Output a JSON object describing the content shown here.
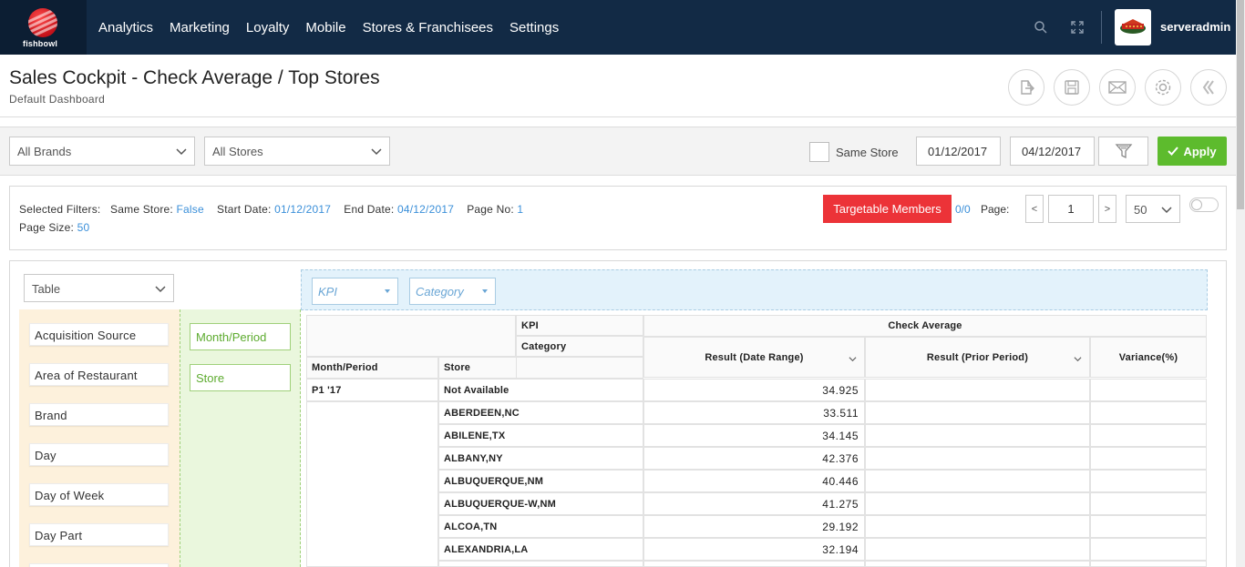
{
  "brand": {
    "logo_text": "fishbowl"
  },
  "nav": {
    "items": [
      "Analytics",
      "Marketing",
      "Loyalty",
      "Mobile",
      "Stores & Franchisees",
      "Settings"
    ]
  },
  "user": {
    "name": "serveradmin"
  },
  "header": {
    "title": "Sales Cockpit - Check Average / Top Stores",
    "subtitle": "Default Dashboard"
  },
  "filters": {
    "brands": "All Brands",
    "stores": "All Stores",
    "same_store_label": "Same Store",
    "start_date": "01/12/2017",
    "end_date": "04/12/2017",
    "apply_label": "Apply"
  },
  "selected": {
    "label": "Selected Filters:",
    "same_store_label": "Same Store:",
    "same_store": "False",
    "start_label": "Start Date:",
    "start": "01/12/2017",
    "end_label": "End Date:",
    "end": "04/12/2017",
    "page_no_label": "Page No:",
    "page_no": "1",
    "page_size_label": "Page Size:",
    "page_size": "50"
  },
  "paging": {
    "targetable_label": "Targetable Members",
    "count": "0/0",
    "page_label": "Page:",
    "prev": "<",
    "next": ">",
    "page": "1",
    "size": "50"
  },
  "pivot": {
    "view": "Table",
    "attributes": [
      "Acquisition Source",
      "Area of Restaurant",
      "Brand",
      "Day",
      "Day of Week",
      "Day Part"
    ],
    "rows": [
      "Month/Period",
      "Store"
    ],
    "columns": [
      "KPI",
      "Category"
    ]
  },
  "table": {
    "kpi_label": "KPI",
    "category_label": "Category",
    "month_header": "Month/Period",
    "store_header": "Store",
    "group_header": "Check Average",
    "col_result": "Result (Date Range)",
    "col_prior": "Result (Prior Period)",
    "col_variance": "Variance(%)",
    "period": "P1 '17",
    "rows": [
      {
        "store": "Not Available",
        "value": "34.925"
      },
      {
        "store": "ABERDEEN,NC",
        "value": "33.511"
      },
      {
        "store": "ABILENE,TX",
        "value": "34.145"
      },
      {
        "store": "ALBANY,NY",
        "value": "42.376"
      },
      {
        "store": "ALBUQUERQUE,NM",
        "value": "40.446"
      },
      {
        "store": "ALBUQUERQUE-W,NM",
        "value": "41.275"
      },
      {
        "store": "ALCOA,TN",
        "value": "29.192"
      },
      {
        "store": "ALEXANDRIA,LA",
        "value": "32.194"
      }
    ]
  },
  "colors": {
    "nav_bg": "#122a45",
    "apply": "#5dbb2d",
    "targetable": "#ec3338",
    "link": "#3a8fd9"
  }
}
